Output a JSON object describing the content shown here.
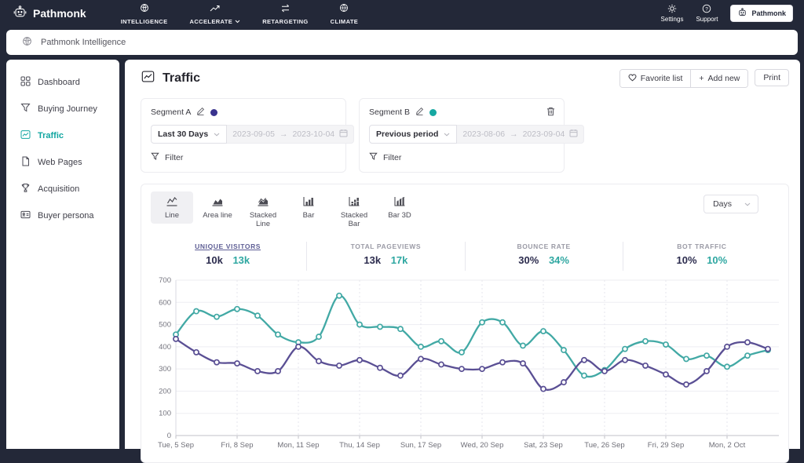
{
  "topnav": {
    "brand": "Pathmonk",
    "items": [
      {
        "label": "INTELLIGENCE"
      },
      {
        "label": "ACCELERATE"
      },
      {
        "label": "RETARGETING"
      },
      {
        "label": "CLIMATE"
      }
    ],
    "settings_label": "Settings",
    "support_label": "Support",
    "account_button": "Pathmonk"
  },
  "breadcrumb": {
    "label": "Pathmonk Intelligence"
  },
  "sidebar": {
    "items": [
      {
        "label": "Dashboard"
      },
      {
        "label": "Buying Journey"
      },
      {
        "label": "Traffic",
        "active": true
      },
      {
        "label": "Web Pages"
      },
      {
        "label": "Acquisition"
      },
      {
        "label": "Buyer persona"
      }
    ]
  },
  "page": {
    "title": "Traffic",
    "actions": {
      "favorite": "Favorite list",
      "add_new": "Add new",
      "print": "Print"
    }
  },
  "glyphs": {
    "range_arrow": "→",
    "plus": "+"
  },
  "segments": [
    {
      "name": "Segment A",
      "dot_color": "#39338e",
      "preset": "Last 30 Days",
      "date_from": "2023-09-05",
      "date_to": "2023-10-04",
      "filter_label": "Filter"
    },
    {
      "name": "Segment B",
      "dot_color": "#16a8a2",
      "preset": "Previous period",
      "date_from": "2023-08-06",
      "date_to": "2023-09-04",
      "filter_label": "Filter"
    }
  ],
  "chart": {
    "tabs": [
      "Line",
      "Area line",
      "Stacked Line",
      "Bar",
      "Stacked Bar",
      "Bar 3D"
    ],
    "active_tab": "Line",
    "interval": "Days"
  },
  "metrics": [
    {
      "label": "UNIQUE VISITORS",
      "a": "10k",
      "b": "13k",
      "active": true
    },
    {
      "label": "TOTAL PAGEVIEWS",
      "a": "13k",
      "b": "17k"
    },
    {
      "label": "BOUNCE RATE",
      "a": "30%",
      "b": "34%"
    },
    {
      "label": "BOT TRAFFIC",
      "a": "10%",
      "b": "10%"
    }
  ],
  "chart_data": {
    "type": "line",
    "title": "Traffic — Unique Visitors per day, Segment A vs Segment B",
    "ylim": [
      0,
      700
    ],
    "yticks": [
      0,
      100,
      200,
      300,
      400,
      500,
      600,
      700
    ],
    "x_count": 30,
    "x_tick_indices": [
      0,
      3,
      6,
      9,
      12,
      15,
      18,
      21,
      24,
      27
    ],
    "x_tick_labels": [
      "Tue, 5 Sep",
      "Fri, 8 Sep",
      "Mon, 11 Sep",
      "Thu, 14 Sep",
      "Sun, 17 Sep",
      "Wed, 20 Sep",
      "Sat, 23 Sep",
      "Tue, 26 Sep",
      "Fri, 29 Sep",
      "Mon, 2 Oct"
    ],
    "grid": true,
    "legend": "none",
    "series": [
      {
        "name": "Segment B",
        "color": "#42a9a5",
        "values": [
          455,
          560,
          535,
          570,
          540,
          455,
          420,
          445,
          630,
          500,
          490,
          480,
          400,
          425,
          375,
          510,
          510,
          405,
          470,
          385,
          270,
          295,
          390,
          425,
          410,
          345,
          360,
          310,
          360,
          385
        ]
      },
      {
        "name": "Segment A",
        "color": "#5a4f94",
        "values": [
          435,
          375,
          330,
          325,
          290,
          290,
          400,
          335,
          315,
          340,
          305,
          270,
          345,
          320,
          300,
          300,
          330,
          325,
          210,
          240,
          340,
          290,
          340,
          315,
          275,
          230,
          290,
          400,
          420,
          390
        ]
      }
    ]
  }
}
